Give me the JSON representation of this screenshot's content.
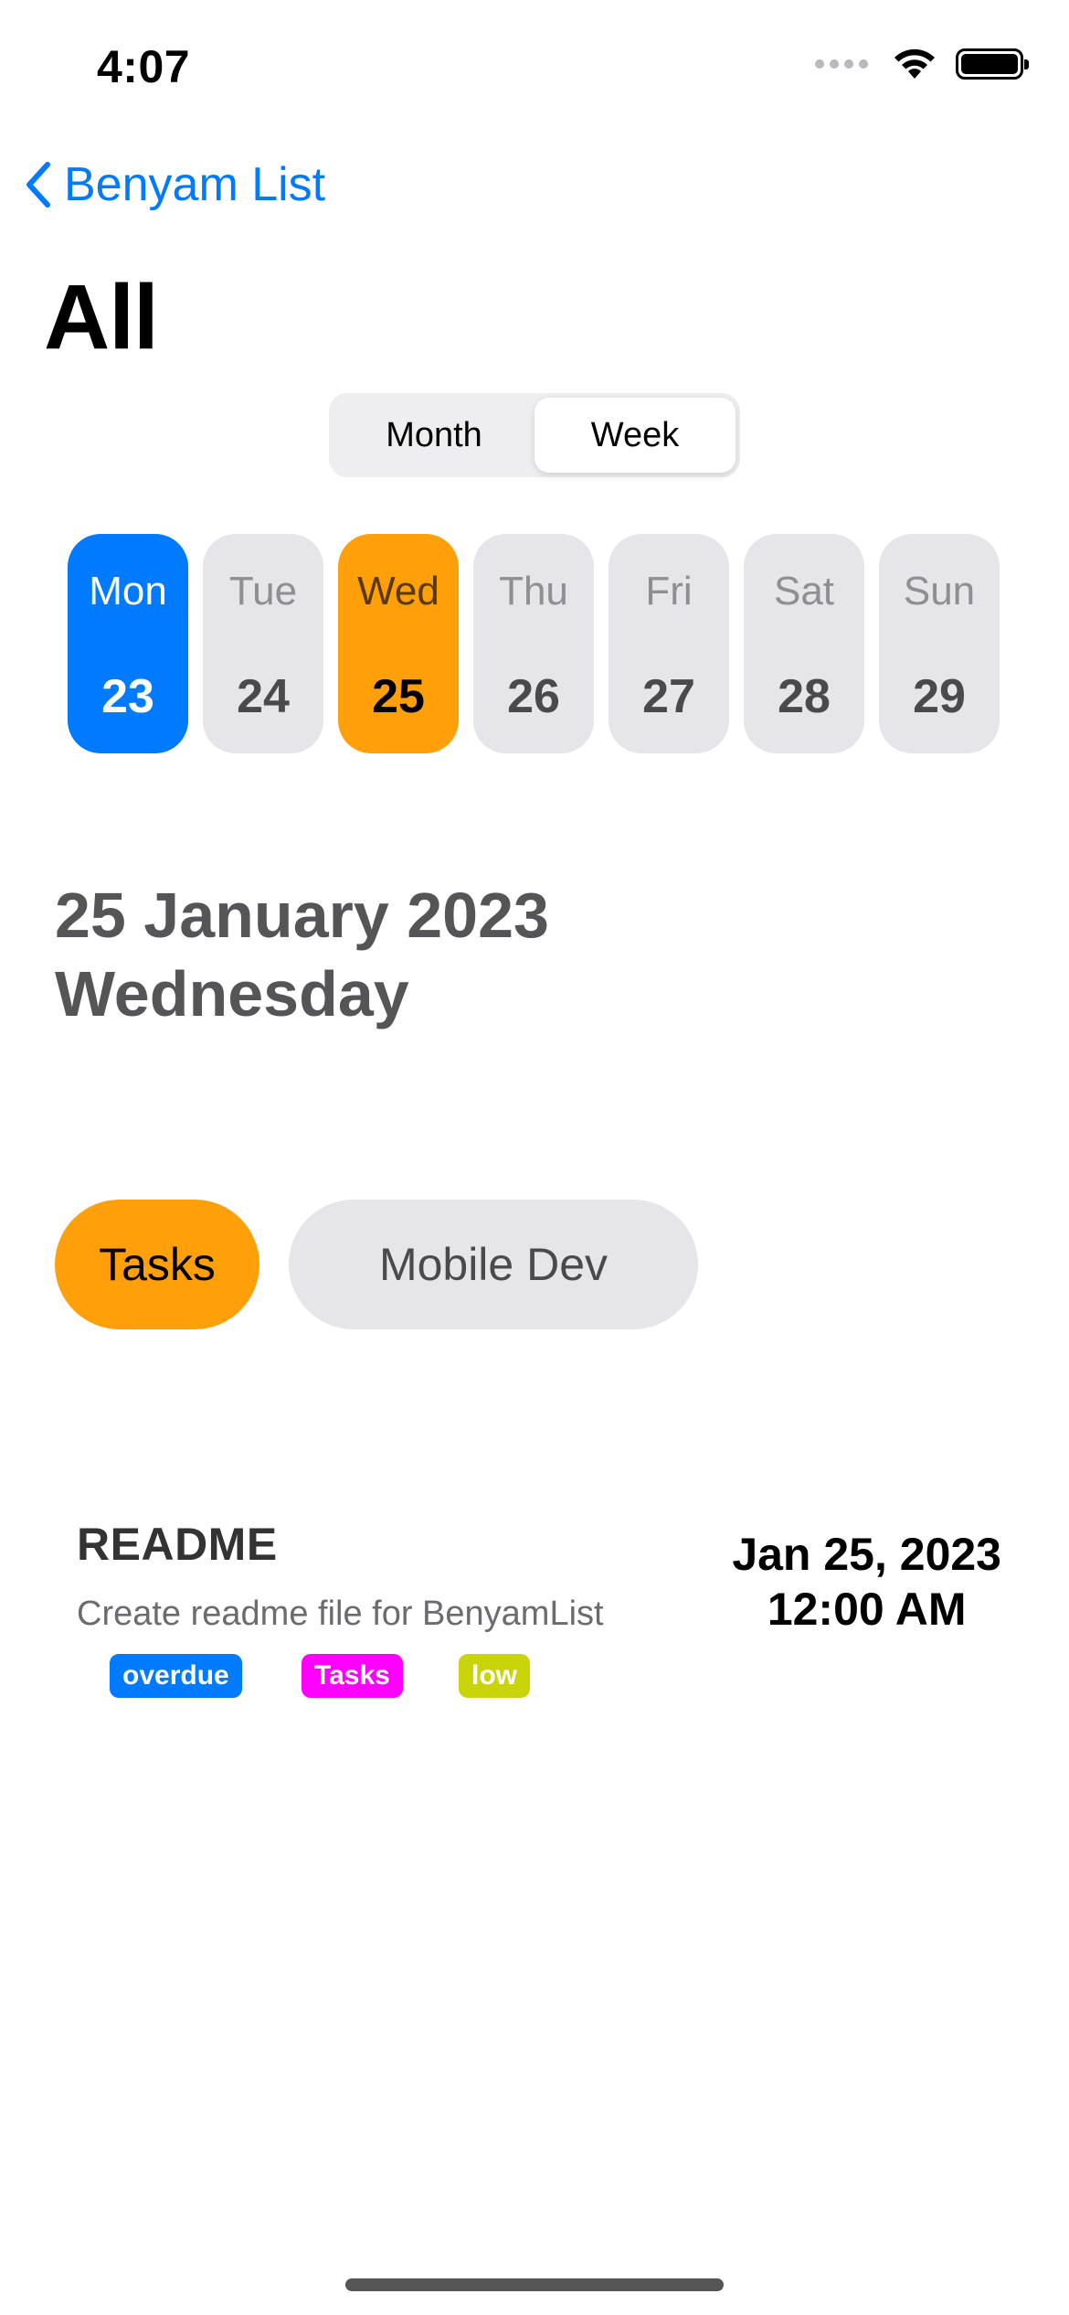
{
  "status_bar": {
    "time": "4:07"
  },
  "nav": {
    "back_label": "Benyam List",
    "title": "All"
  },
  "view_switch": {
    "options": [
      "Month",
      "Week"
    ],
    "selected": "Week"
  },
  "week": [
    {
      "name": "Mon",
      "number": "23"
    },
    {
      "name": "Tue",
      "number": "24"
    },
    {
      "name": "Wed",
      "number": "25"
    },
    {
      "name": "Thu",
      "number": "26"
    },
    {
      "name": "Fri",
      "number": "27"
    },
    {
      "name": "Sat",
      "number": "28"
    },
    {
      "name": "Sun",
      "number": "29"
    }
  ],
  "selected_date": {
    "line1": "25 January 2023",
    "line2": "Wednesday"
  },
  "categories": [
    "Tasks",
    "Mobile Dev"
  ],
  "task": {
    "title": "README",
    "description": "Create readme file for BenyamList",
    "tags": [
      {
        "label": "overdue",
        "color": "#007aff"
      },
      {
        "label": "Tasks",
        "color": "#ff00ff"
      },
      {
        "label": "low",
        "color": "#c9d40a"
      }
    ],
    "due_date": "Jan 25, 2023",
    "due_time": "12:00 AM"
  },
  "colors": {
    "accent": "#007aff",
    "highlight": "#ff9f0a",
    "chip_inactive": "#e5e5ea"
  }
}
